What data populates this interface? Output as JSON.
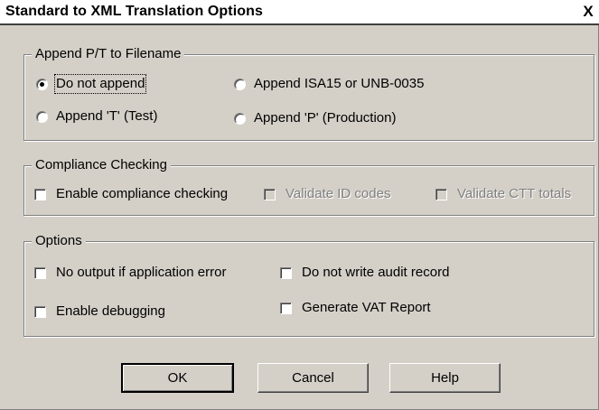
{
  "dialog": {
    "title": "Standard to XML Translation Options",
    "close_label": "X"
  },
  "append_group": {
    "legend": "Append P/T to Filename",
    "options": [
      {
        "label": "Do not append",
        "checked": true
      },
      {
        "label": "Append ISA15 or UNB-0035",
        "checked": false
      },
      {
        "label": "Append 'T' (Test)",
        "checked": false
      },
      {
        "label": "Append 'P' (Production)",
        "checked": false
      }
    ]
  },
  "compliance_group": {
    "legend": "Compliance Checking",
    "enable_label": "Enable compliance checking",
    "validate_id_label": "Validate ID codes",
    "validate_ctt_label": "Validate CTT totals"
  },
  "options_group": {
    "legend": "Options",
    "no_output_label": "No output if application error",
    "no_audit_label": "Do not write audit record",
    "debugging_label": "Enable debugging",
    "vat_label": "Generate VAT Report"
  },
  "buttons": {
    "ok": "OK",
    "cancel": "Cancel",
    "help": "Help"
  }
}
